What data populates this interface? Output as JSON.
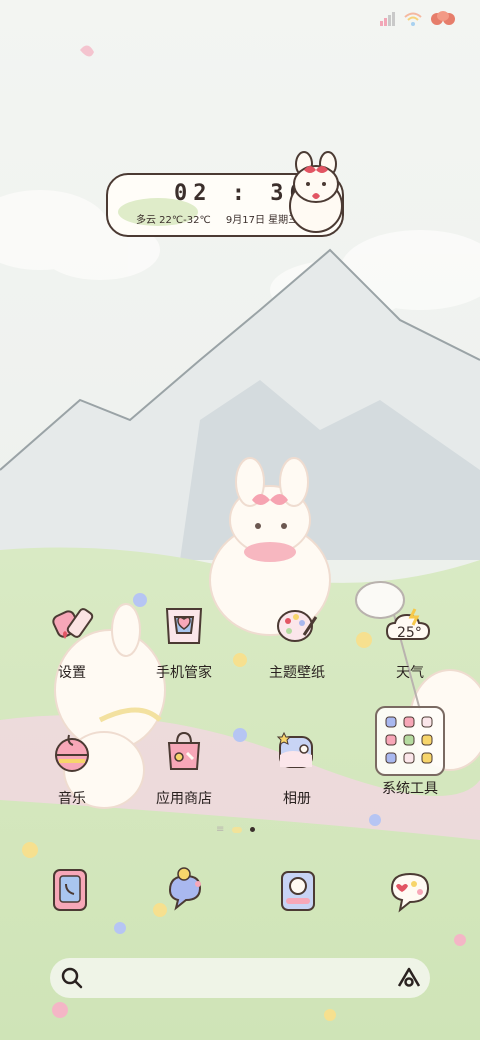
{
  "status": {
    "icons": [
      "signal-icon",
      "wifi-icon",
      "battery-icon"
    ]
  },
  "clock_widget": {
    "time": "02 : 36",
    "weather": "多云 22℃-32℃",
    "date": "9月17日 星期三"
  },
  "apps": [
    {
      "label": "设置",
      "icon": "settings-icon"
    },
    {
      "label": "手机管家",
      "icon": "phone-manager-icon"
    },
    {
      "label": "主题壁纸",
      "icon": "themes-icon"
    },
    {
      "label": "天气",
      "icon": "weather-icon",
      "badge": "25°"
    },
    {
      "label": "音乐",
      "icon": "music-icon"
    },
    {
      "label": "应用商店",
      "icon": "app-store-icon"
    },
    {
      "label": "相册",
      "icon": "gallery-icon"
    },
    {
      "label": "系统工具",
      "icon": "system-tools-folder-icon"
    }
  ],
  "dock": [
    "phone-icon",
    "messages-icon",
    "camera-icon",
    "chat-icon"
  ],
  "search": {
    "icons": [
      "search-icon",
      "assistant-icon"
    ]
  },
  "colors": {
    "outline": "#4b3a33",
    "pink": "#f7a7b8",
    "yellow": "#f7d56b",
    "blue": "#a9b8ef"
  }
}
